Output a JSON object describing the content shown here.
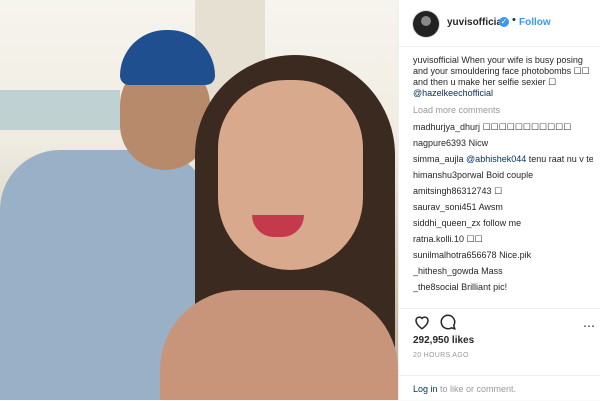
{
  "post": {
    "username": "yuvisofficial",
    "follow_label": "Follow",
    "caption_text": "When your wife is busy posing and your smouldering face photobombs ☐☐ and then u make her selfie sexier ☐",
    "caption_mention": "@hazelkeechofficial",
    "load_more": "Load more comments",
    "comments": [
      {
        "user": "madhurjya_dhurj",
        "text": "☐☐☐☐☐☐☐☐☐☐☐"
      },
      {
        "user": "nagpure6393",
        "text": "Nicw"
      },
      {
        "user": "simma_aujla",
        "mention": "@abhishek044",
        "text": "tenu raat nu v teeek nai ...."
      },
      {
        "user": "himanshu3porwal",
        "text": "Boid couple"
      },
      {
        "user": "amitsingh86312743",
        "text": "☐"
      },
      {
        "user": "saurav_soni451",
        "text": "Awsm"
      },
      {
        "user": "siddhi_queen_zx",
        "text": "follow me"
      },
      {
        "user": "ratna.kolli.10",
        "text": "☐☐"
      },
      {
        "user": "sunilmalhotra656678",
        "text": "Nice.pik"
      },
      {
        "user": "_hithesh_gowda",
        "text": "Mass"
      },
      {
        "user": "_the8social",
        "text": "Brilliant pic!"
      }
    ],
    "likes": "292,950 likes",
    "time": "20 HOURS AGO",
    "login_link": "Log in",
    "login_rest": " to like or comment.",
    "colors": {
      "link": "#3897f0",
      "mention": "#003569"
    }
  }
}
